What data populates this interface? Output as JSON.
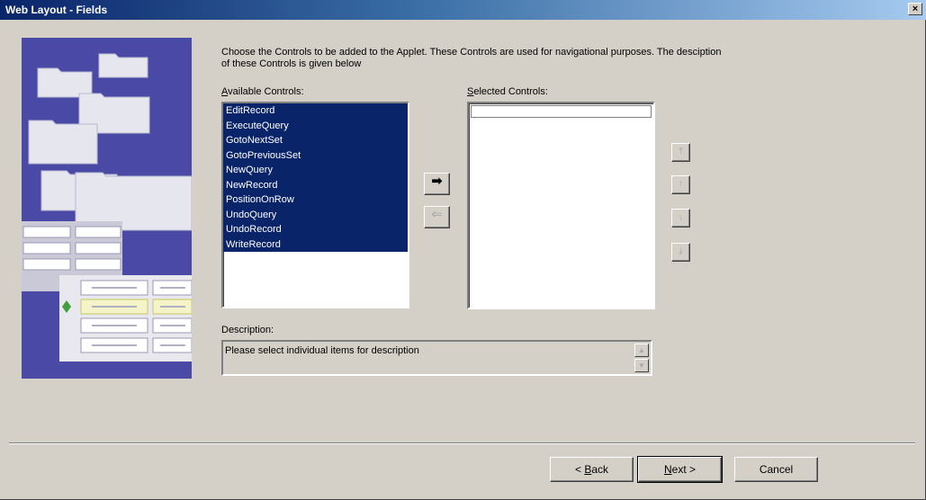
{
  "window": {
    "title": "Web Layout - Fields",
    "close_glyph": "×"
  },
  "intro_text": "Choose the Controls to be added to the Applet. These Controls are used for navigational purposes. The desciption of these Controls is given below",
  "available": {
    "label_accel": "A",
    "label_rest": "vailable Controls:",
    "items": [
      "EditRecord",
      "ExecuteQuery",
      "GotoNextSet",
      "GotoPreviousSet",
      "NewQuery",
      "NewRecord",
      "PositionOnRow",
      "UndoQuery",
      "UndoRecord",
      "WriteRecord"
    ]
  },
  "selected": {
    "label_accel": "S",
    "label_rest": "elected Controls:",
    "items": []
  },
  "move_buttons": {
    "right_glyph": "➡",
    "left_glyph": "⇐"
  },
  "order_buttons": {
    "top_glyph": "⤒",
    "up_glyph": "↑",
    "down_glyph": "↓",
    "bottom_glyph": "⤓"
  },
  "description": {
    "label": "Description:",
    "text": "Please select individual items for description"
  },
  "footer": {
    "back_prefix": "< ",
    "back_accel": "B",
    "back_rest": "ack",
    "next_accel": "N",
    "next_rest": "ext >",
    "cancel": "Cancel"
  },
  "colors": {
    "selection": "#0a246a",
    "face": "#d4d0c8",
    "illustration": "#4a4aa6"
  }
}
